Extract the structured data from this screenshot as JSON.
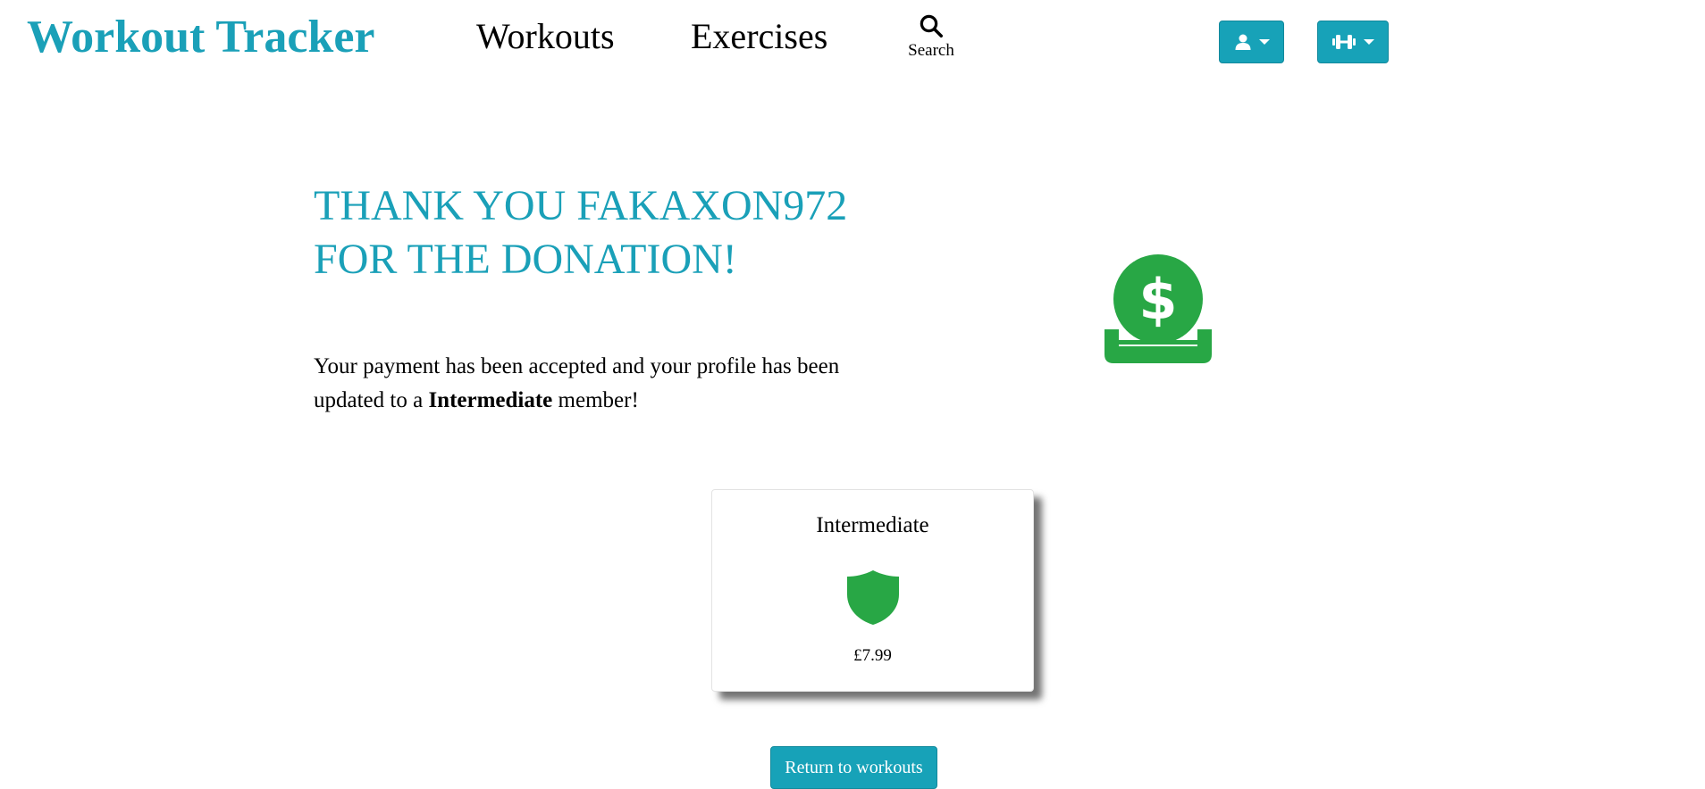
{
  "navbar": {
    "brand": "Workout Tracker",
    "links": {
      "workouts": "Workouts",
      "exercises": "Exercises"
    },
    "search": {
      "label": "Search",
      "icon": "search-icon"
    },
    "user_menu_icon": "user-icon",
    "gym_menu_icon": "dumbbell-icon"
  },
  "hero": {
    "title": "THANK YOU FAKAXON972 FOR THE DONATION!",
    "message_before": "Your payment has been accepted and your profile has been updated to a ",
    "message_bold": "Intermediate",
    "message_after": " member!",
    "illustration_icon": "money-deposit-icon"
  },
  "tier_card": {
    "name": "Intermediate",
    "icon": "shield-icon",
    "price": "£7.99"
  },
  "actions": {
    "return_label": "Return to workouts"
  },
  "colors": {
    "brand": "#1aa0b8",
    "button": "#17a2b8",
    "success": "#28a745"
  }
}
